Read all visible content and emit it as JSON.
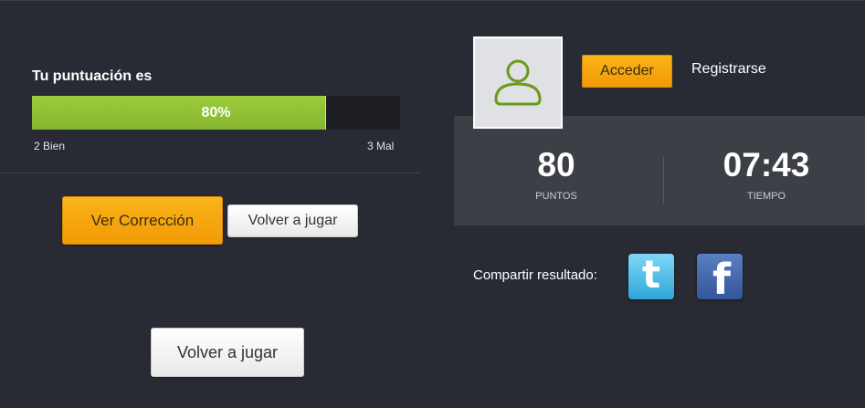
{
  "score": {
    "title": "Tu puntuación es",
    "percent": 80,
    "percent_label": "80%",
    "correct_label": "2 Bien",
    "wrong_label": "3 Mal"
  },
  "actions": {
    "view_correction": "Ver Corrección",
    "replay_small": "Volver a jugar",
    "replay_big": "Volver a jugar"
  },
  "user": {
    "avatar_icon": "user-avatar-icon",
    "login_label": "Acceder",
    "register_label": "Registrarse"
  },
  "stats": {
    "points_value": "80",
    "points_label": "PUNTOS",
    "time_value": "07:43",
    "time_label": "TIEMPO"
  },
  "share": {
    "label": "Compartir resultado:",
    "twitter_icon": "twitter-icon",
    "facebook_icon": "facebook-icon"
  },
  "colors": {
    "background": "#282b33",
    "accent_orange": "#f5a30c",
    "progress_green": "#8fc135",
    "stats_panel": "#3c3f46"
  }
}
